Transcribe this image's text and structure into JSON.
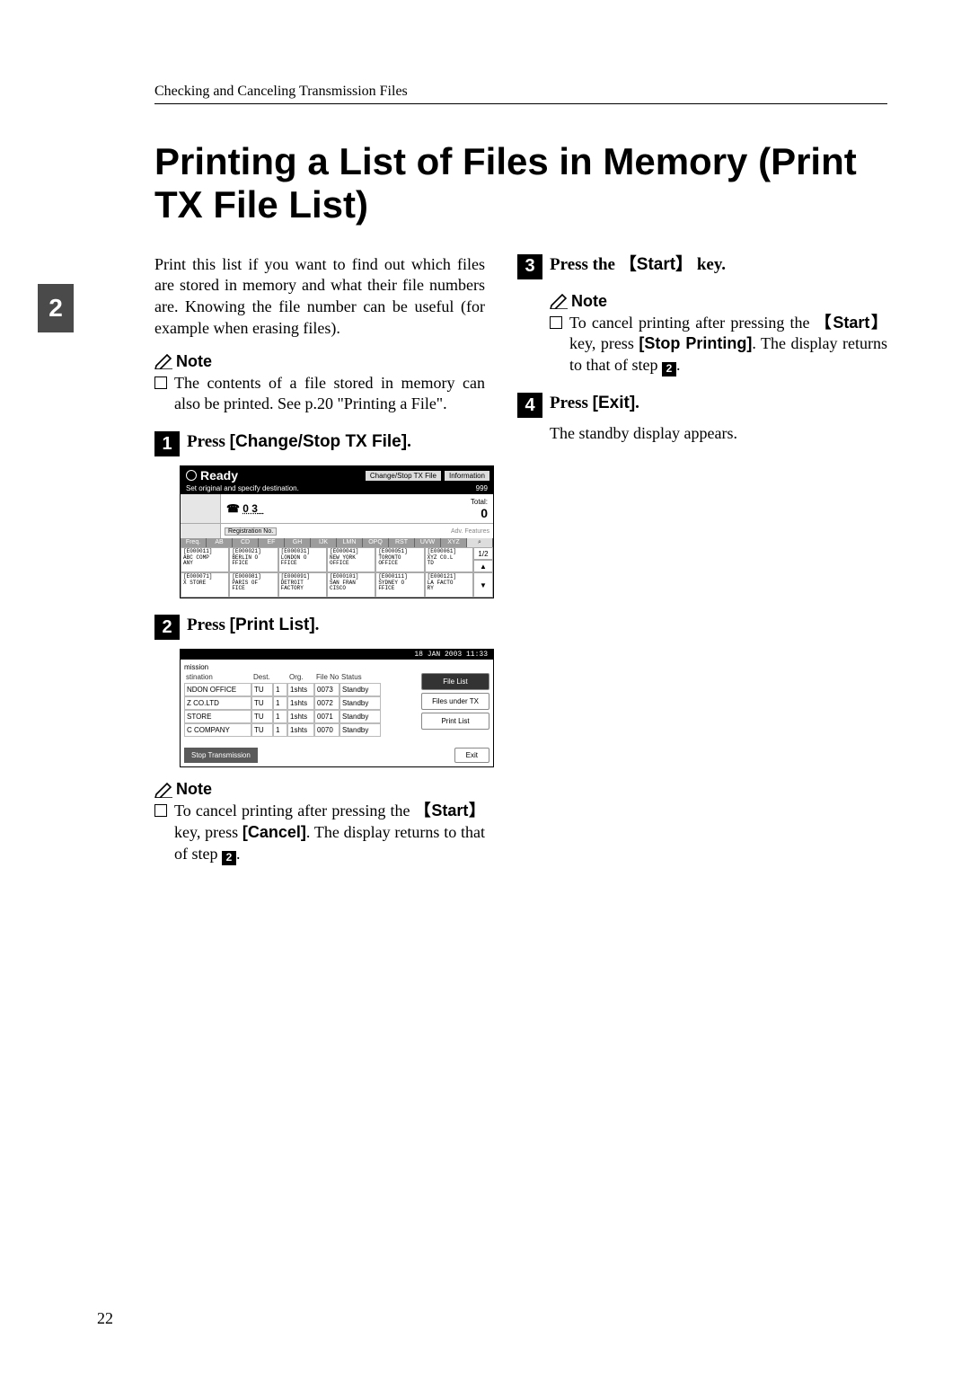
{
  "header": "Checking and Canceling Transmission Files",
  "tab_number": "2",
  "title": "Printing a List of Files in Memory (Print TX File List)",
  "left": {
    "intro": "Print this list if you want to find out which files are stored in memory and what their file numbers are. Knowing the file number can be useful (for example when erasing files).",
    "note_label": "Note",
    "note1": "The contents of a file stored in memory can also be printed. See p.20 \"Printing a File\".",
    "step1_label": "Press ",
    "step1_btn": "[Change/Stop TX File]",
    "step1_after": ".",
    "step2_label": "Press ",
    "step2_btn": "[Print List]",
    "step2_after": ".",
    "note2_pre": "To cancel printing after pressing the ",
    "note2_key": "Start",
    "note2_mid": " key, press ",
    "note2_btn": "[Cancel]",
    "note2_post1": ". The display returns to that of step ",
    "note2_stepnum": "2",
    "note2_post2": "."
  },
  "right": {
    "step3_label": "Press the ",
    "step3_key": "Start",
    "step3_after": " key.",
    "note_label": "Note",
    "note3_pre": "To cancel printing after pressing the ",
    "note3_key": "Start",
    "note3_mid": " key, press ",
    "note3_btn": "[Stop Printing]",
    "note3_post1": ". The display returns to that of step ",
    "note3_stepnum": "2",
    "note3_post2": ".",
    "step4_label": "Press ",
    "step4_btn": "[Exit]",
    "step4_after": ".",
    "standby": "The standby display appears."
  },
  "ss1": {
    "ready": "Ready",
    "top_btn1": "Change/Stop TX File",
    "top_btn2": "Information",
    "sub": "Set original and specify destination.",
    "count999": "999",
    "tel_icon": "☎",
    "tel_num": "0 3_",
    "total_label": "Total:",
    "total_num": "0",
    "reg": "Registration No.",
    "adv": "Adv. Features",
    "alpha": [
      "Freq.",
      "AB",
      "CD",
      "EF",
      "GH",
      "IJK",
      "LMN",
      "OPQ",
      "RST",
      "UVW",
      "XYZ",
      "⌕"
    ],
    "tiles": [
      [
        "E000011",
        "ABC COMP",
        "ANY"
      ],
      [
        "E000021",
        "BERLIN O",
        "FFICE"
      ],
      [
        "E000031",
        "LONDON O",
        "FFICE"
      ],
      [
        "E000041",
        "NEW YORK",
        "OFFICE"
      ],
      [
        "E000051",
        "TORONTO",
        "OFFICE"
      ],
      [
        "E000061",
        "XYZ CO.L",
        "TD"
      ],
      [
        "E000071",
        "X STORE",
        ""
      ],
      [
        "E000081",
        "PARIS OF",
        "FICE"
      ],
      [
        "E000091",
        "DETROIT",
        "FACTORY"
      ],
      [
        "E000101",
        "SAN FRAN",
        "CISCO"
      ],
      [
        "E000111",
        "SYDNEY O",
        "FFICE"
      ],
      [
        "E000121",
        "LA FACTO",
        "RY"
      ]
    ],
    "side_page": "1/2",
    "side_up": "▲",
    "side_down": "▼"
  },
  "ss2": {
    "timestamp": "18 JAN 2003 11:33",
    "mission": "mission",
    "headers": [
      "stination",
      "Dest.",
      "",
      "Org.",
      "File No.",
      "Status"
    ],
    "rows": [
      [
        "NDON OFFICE",
        "TU",
        "1",
        "1shts",
        "0073",
        "Standby"
      ],
      [
        "Z CO.LTD",
        "TU",
        "1",
        "1shts",
        "0072",
        "Standby"
      ],
      [
        "STORE",
        "TU",
        "1",
        "1shts",
        "0071",
        "Standby"
      ],
      [
        "C COMPANY",
        "TU",
        "1",
        "1shts",
        "0070",
        "Standby"
      ]
    ],
    "btn_filelist": "File List",
    "btn_filesunder": "Files under TX",
    "btn_printlist": "Print List",
    "stop": "Stop Transmission",
    "exit": "Exit"
  },
  "page_number": "22"
}
